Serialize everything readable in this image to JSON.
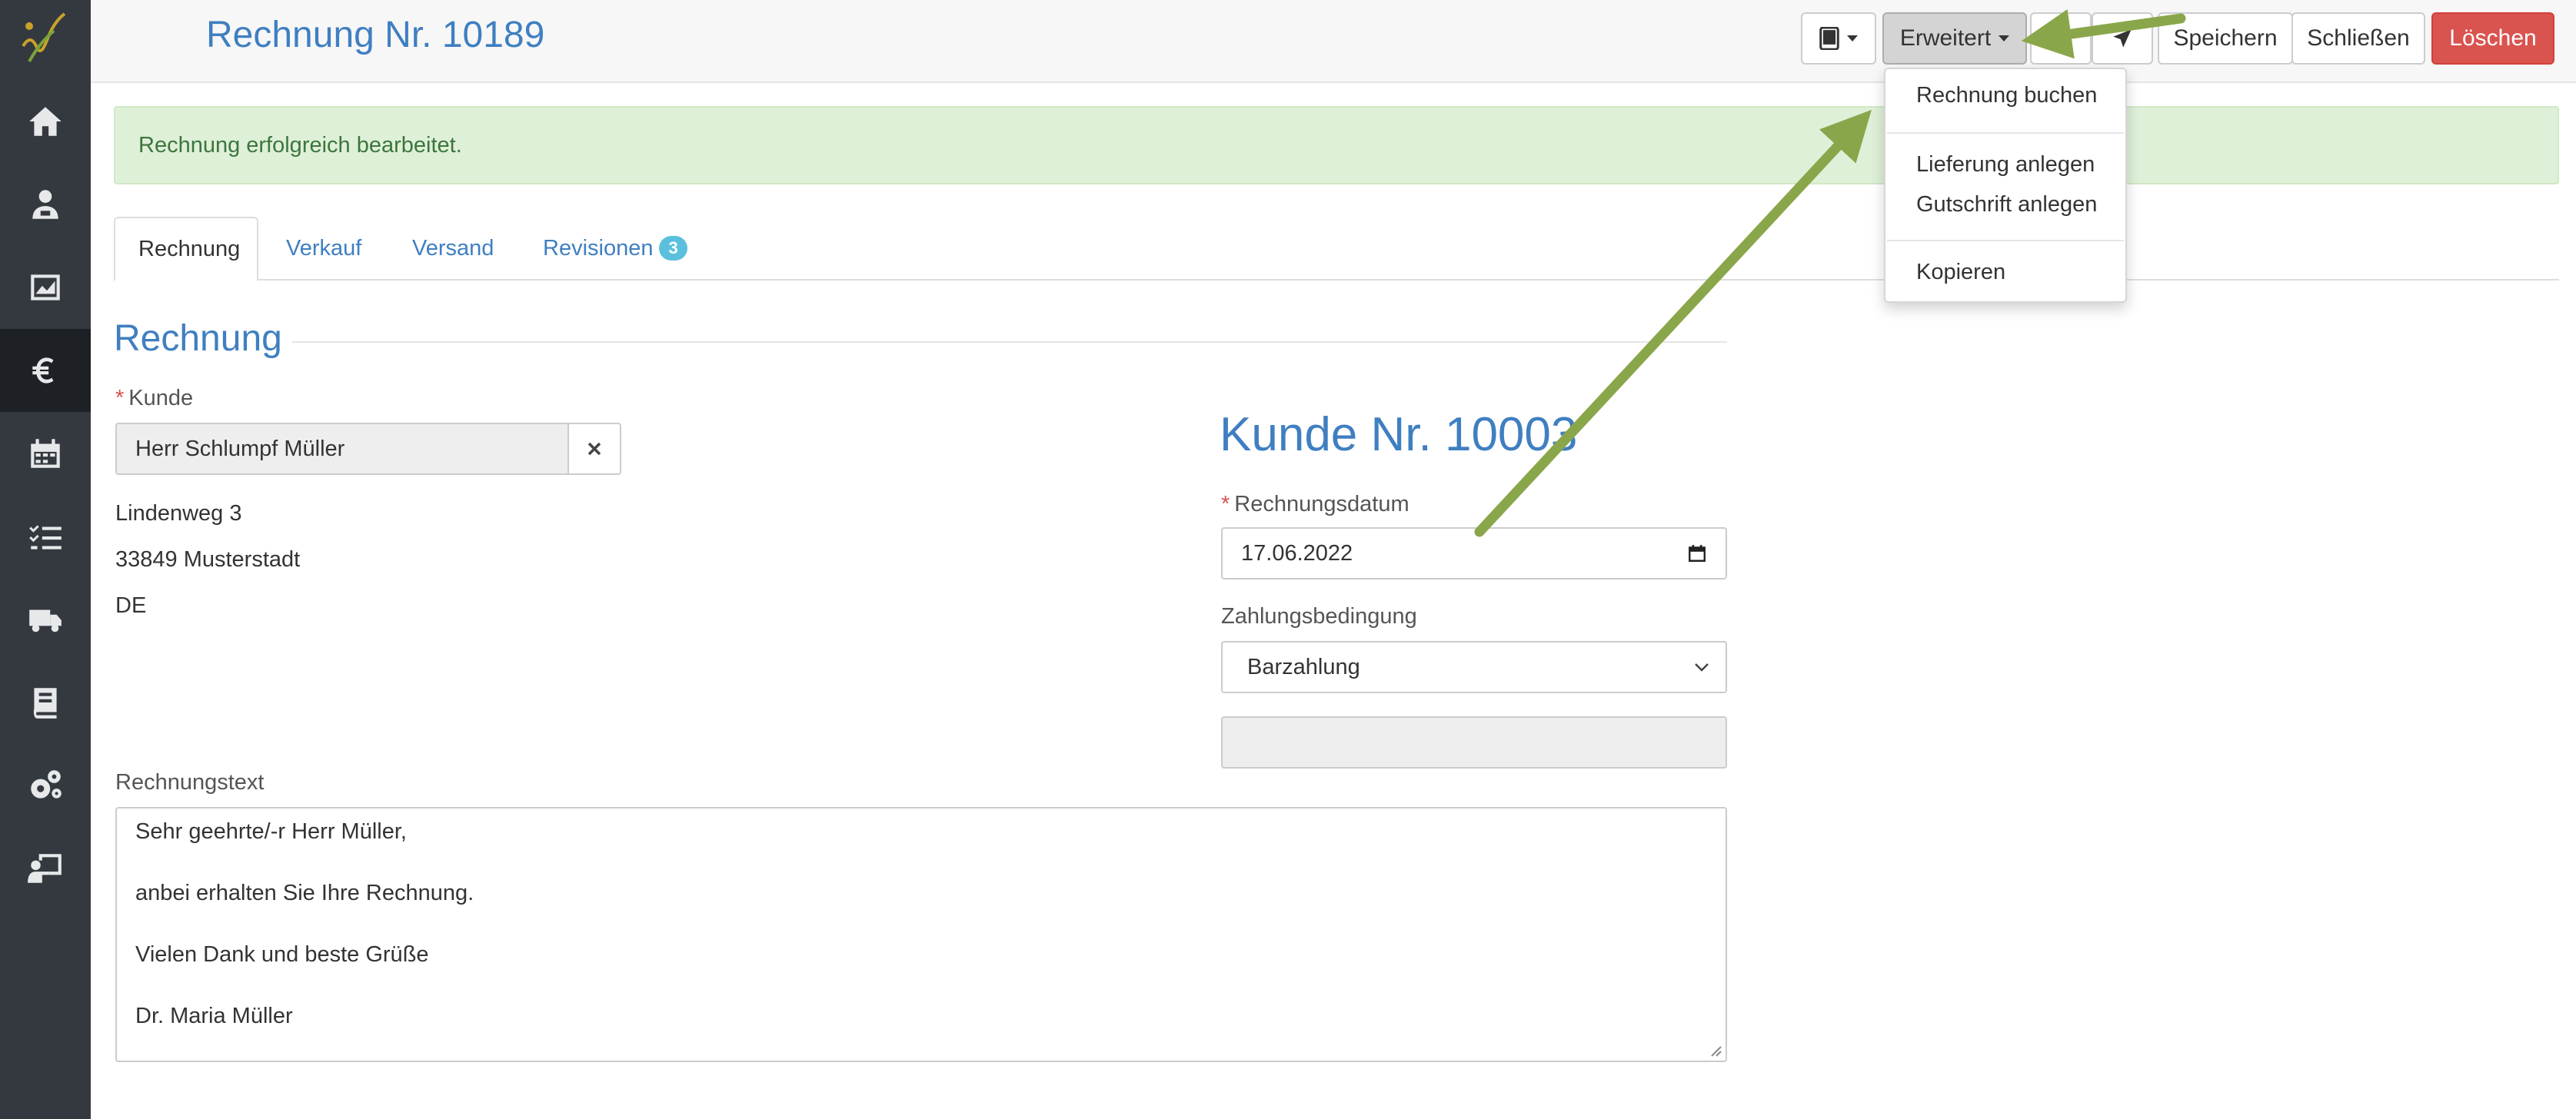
{
  "sidebar": {
    "items": [
      {
        "icon": "home-icon",
        "active": false
      },
      {
        "icon": "customer-icon",
        "active": false
      },
      {
        "icon": "dashboard-icon",
        "active": false
      },
      {
        "icon": "euro-icon",
        "active": true
      },
      {
        "icon": "calendar-icon",
        "active": false
      },
      {
        "icon": "tasks-icon",
        "active": false
      },
      {
        "icon": "truck-icon",
        "active": false
      },
      {
        "icon": "book-icon",
        "active": false
      },
      {
        "icon": "settings-icon",
        "active": false
      },
      {
        "icon": "presentation-icon",
        "active": false
      }
    ]
  },
  "header": {
    "title": "Rechnung Nr. 10189",
    "toolbar": {
      "print_icon": "print-icon",
      "advanced_label": "Erweitert",
      "save_label": "Speichern",
      "close_label": "Schließen",
      "delete_label": "Löschen"
    }
  },
  "dropdown": {
    "items": [
      {
        "label": "Rechnung buchen"
      },
      {
        "label": "Lieferung anlegen"
      },
      {
        "label": "Gutschrift anlegen"
      },
      {
        "label": "Kopieren"
      }
    ]
  },
  "alert": {
    "message": "Rechnung erfolgreich bearbeitet."
  },
  "tabs": [
    {
      "label": "Rechnung",
      "active": true
    },
    {
      "label": "Verkauf",
      "active": false
    },
    {
      "label": "Versand",
      "active": false
    },
    {
      "label": "Revisionen",
      "active": false,
      "badge": "3"
    }
  ],
  "form": {
    "section_title": "Rechnung",
    "customer": {
      "label": "Kunde",
      "required_mark": "*",
      "value": "Herr Schlumpf Müller",
      "address": [
        "Lindenweg 3",
        "33849 Musterstadt",
        "DE"
      ]
    },
    "customer_number_heading": "Kunde Nr. 10003",
    "invoice_date": {
      "label": "Rechnungsdatum",
      "required_mark": "*",
      "value": "17.06.2022"
    },
    "payment_terms": {
      "label": "Zahlungsbedingung",
      "value": "Barzahlung"
    },
    "invoice_text": {
      "label": "Rechnungstext",
      "lines": [
        "Sehr geehrte/-r Herr Müller,",
        "anbei erhalten Sie Ihre Rechnung.",
        "Vielen Dank und beste Grüße",
        "Dr. Maria Müller"
      ]
    }
  },
  "colors": {
    "sidebar_bg": "#34393f",
    "accent_blue": "#3f7fc1",
    "danger_red": "#d9534f",
    "success_bg": "#dff0d8",
    "success_text": "#3c763d",
    "annotation_arrow": "#8aa64a"
  }
}
